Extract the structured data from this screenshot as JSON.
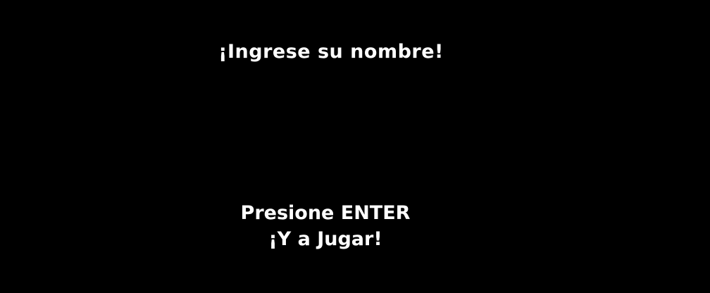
{
  "screen": {
    "title": "¡Ingrese su nombre!",
    "name_value": "",
    "prompt_line1": "Presione ENTER",
    "prompt_line2": "¡Y a Jugar!"
  },
  "colors": {
    "background": "#000000",
    "text": "#ffffff"
  }
}
